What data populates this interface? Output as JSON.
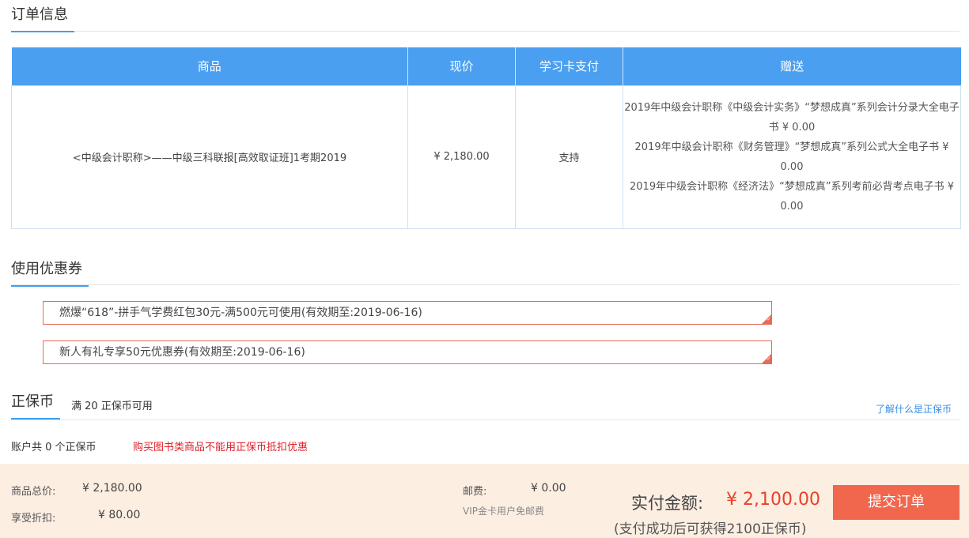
{
  "order": {
    "section_title": "订单信息",
    "headers": [
      "商品",
      "现价",
      "学习卡支付",
      "赠送"
    ],
    "row": {
      "product": "<中级会计职称>——中级三科联报[高效取证班]1考期2019",
      "price": "¥ 2,180.00",
      "card_pay": "支持",
      "gifts": [
        "2019年中级会计职称《中级会计实务》“梦想成真”系列会计分录大全电子书 ¥ 0.00",
        "2019年中级会计职称《财务管理》“梦想成真”系列公式大全电子书 ¥ 0.00",
        "2019年中级会计职称《经济法》“梦想成真”系列考前必背考点电子书 ¥ 0.00"
      ]
    }
  },
  "coupon": {
    "section_title": "使用优惠券",
    "items": [
      "燃爆“618”-拼手气学费红包30元-满500元可使用(有效期至:2019-06-16)",
      "新人有礼专享50元优惠券(有效期至:2019-06-16)"
    ]
  },
  "coin": {
    "section_title": "正保币",
    "available": "满 20 正保币可用",
    "link": "了解什么是正保币",
    "balance": "账户共 0 个正保币",
    "warning": "购买图书类商品不能用正保币抵扣优惠"
  },
  "footer": {
    "total_label": "商品总价:",
    "total_value": "¥ 2,180.00",
    "discount_label": "享受折扣:",
    "discount_value": "¥ 80.00",
    "shipping_label": "邮费:",
    "shipping_value": "¥ 0.00",
    "shipping_note": "VIP金卡用户免邮费",
    "pay_label": "实付金额:",
    "pay_amount": "¥ 2,100.00",
    "pay_note": "(支付成功后可获得2100正保币)",
    "submit_label": "提交订单"
  },
  "colors": {
    "header_blue": "#4a9ff0",
    "accent_orange": "#f0674e",
    "price_red": "#e8412a",
    "footer_bg": "#fdeee2"
  }
}
